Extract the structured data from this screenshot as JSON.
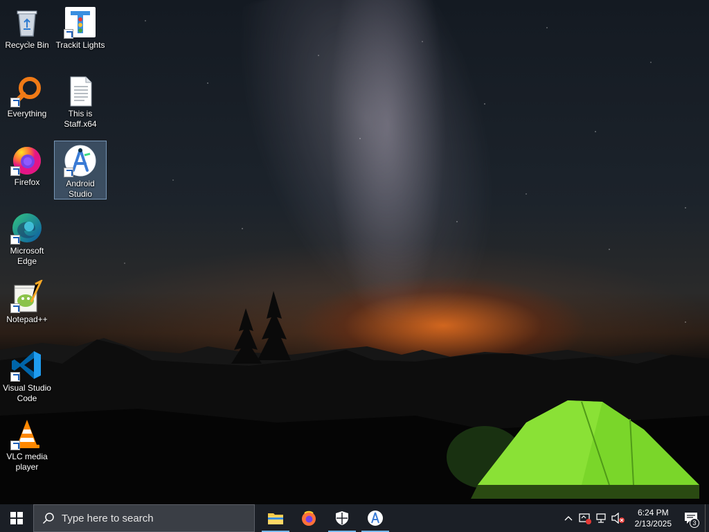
{
  "desktop": {
    "icons": [
      {
        "label": "Recycle Bin",
        "icon": "recycle-bin-icon",
        "shortcut": false
      },
      {
        "label": "Trackit Lights",
        "icon": "traffic-light-icon",
        "shortcut": true
      },
      {
        "label": "Everything",
        "icon": "magnifier-icon",
        "shortcut": true
      },
      {
        "label": "This is Staff.x64",
        "icon": "text-file-icon",
        "shortcut": false
      },
      {
        "label": "Firefox",
        "icon": "firefox-icon",
        "shortcut": true
      },
      {
        "label": "Android Studio",
        "icon": "android-studio-icon",
        "shortcut": true,
        "selected": true
      },
      {
        "label": "Microsoft Edge",
        "icon": "edge-icon",
        "shortcut": true
      },
      {
        "label": "Notepad++",
        "icon": "notepadpp-icon",
        "shortcut": true
      },
      {
        "label": "Visual Studio Code",
        "icon": "vscode-icon",
        "shortcut": true
      },
      {
        "label": "VLC media player",
        "icon": "vlc-icon",
        "shortcut": true
      }
    ]
  },
  "taskbar": {
    "search_placeholder": "Type here to search",
    "pinned": [
      {
        "name": "File Explorer",
        "icon": "folder-icon",
        "running": true
      },
      {
        "name": "Firefox",
        "icon": "firefox-icon",
        "running": false
      },
      {
        "name": "Windows Security",
        "icon": "shield-icon",
        "running": true
      },
      {
        "name": "Android Studio",
        "icon": "android-studio-icon",
        "running": true
      }
    ],
    "tray": {
      "time": "6:24 PM",
      "date": "2/13/2025",
      "notification_count": "3"
    }
  },
  "colors": {
    "taskbar_bg": "#1b1f26",
    "running_indicator": "#76b9ed",
    "selection": "#78a0c8"
  }
}
